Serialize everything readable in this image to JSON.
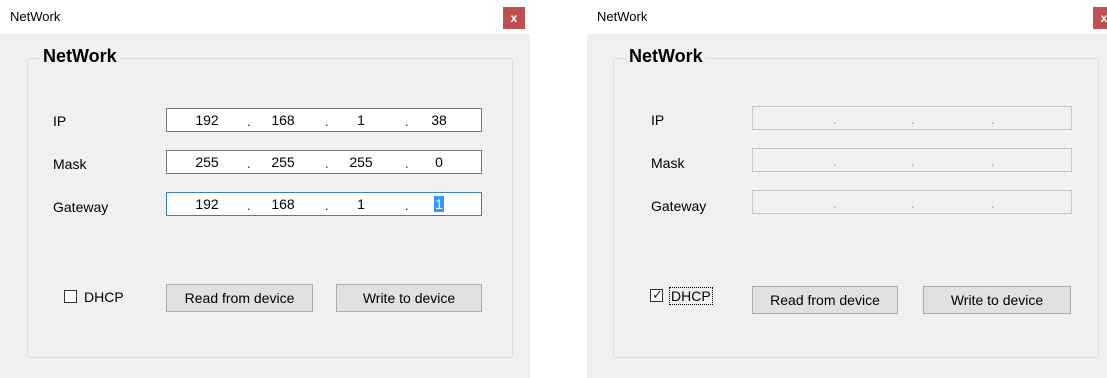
{
  "left_window": {
    "title": "NetWork",
    "close_label": "x",
    "group_title": "NetWork",
    "labels": {
      "ip": "IP",
      "mask": "Mask",
      "gateway": "Gateway"
    },
    "ip": [
      "192",
      "168",
      "1",
      "38"
    ],
    "mask": [
      "255",
      "255",
      "255",
      "0"
    ],
    "gateway": [
      "192",
      "168",
      "1",
      "1"
    ],
    "dots": ".",
    "dhcp": {
      "label": "DHCP",
      "checked": false
    },
    "read_button": "Read from device",
    "write_button": "Write to device"
  },
  "right_window": {
    "title": "NetWork",
    "close_label": "x",
    "group_title": "NetWork",
    "labels": {
      "ip": "IP",
      "mask": "Mask",
      "gateway": "Gateway"
    },
    "ip": [
      "",
      "",
      "",
      ""
    ],
    "mask": [
      "",
      "",
      "",
      ""
    ],
    "gateway": [
      "",
      "",
      "",
      ""
    ],
    "dots": ".",
    "dhcp": {
      "label": "DHCP",
      "checked": true,
      "check_glyph": "✓"
    },
    "read_button": "Read from device",
    "write_button": "Write to device"
  },
  "colors": {
    "close_button": "#c0504d",
    "window_bg": "#f0f0f0",
    "selection": "#3399ff"
  }
}
